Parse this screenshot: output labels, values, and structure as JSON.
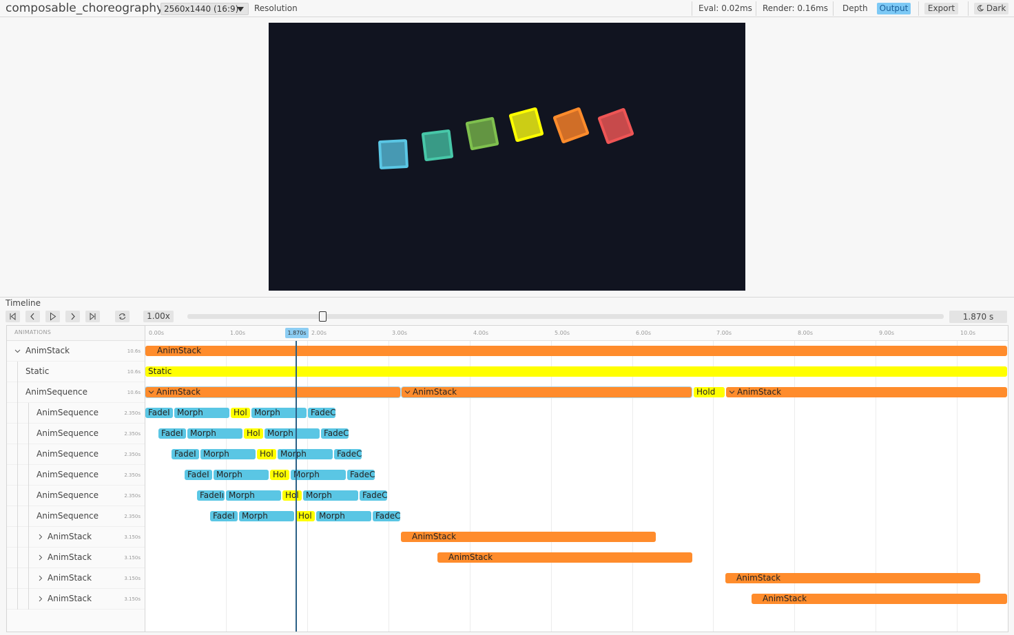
{
  "topbar": {
    "title": "composable_choreography",
    "resolution_value": "2560x1440 (16:9)",
    "resolution_label": "Resolution",
    "eval": "Eval: 0.02ms",
    "render": "Render: 0.16ms",
    "depth": "Depth",
    "output": "Output",
    "export": "Export",
    "dark": "Dark"
  },
  "viewport": {
    "background": "#111420",
    "squares": [
      {
        "color": "#5ac6e4"
      },
      {
        "color": "#47c7a8"
      },
      {
        "color": "#7fc04e"
      },
      {
        "color": "#ffff00"
      },
      {
        "color": "#ff8c2c"
      },
      {
        "color": "#ee5555"
      }
    ]
  },
  "timeline": {
    "title": "Timeline",
    "speed": "1.00x",
    "time": "1.870 s",
    "scrub_fraction": 0.177,
    "header_label": "ANIMATIONS",
    "ticks": [
      "0.00s",
      "1.00s",
      "1.870s",
      "2.00s",
      "3.00s",
      "4.00s",
      "5.00s",
      "6.00s",
      "7.00s",
      "8.00s",
      "9.00s",
      "10.0s"
    ],
    "current_time_label": "1.870s",
    "rows": [
      {
        "name": "AnimStack",
        "duration": "10.6s"
      },
      {
        "name": "Static",
        "duration": "10.6s"
      },
      {
        "name": "AnimSequence",
        "duration": "10.6s"
      },
      {
        "name": "AnimSequence",
        "duration": "2.350s"
      },
      {
        "name": "AnimSequence",
        "duration": "2.350s"
      },
      {
        "name": "AnimSequence",
        "duration": "2.350s"
      },
      {
        "name": "AnimSequence",
        "duration": "2.350s"
      },
      {
        "name": "AnimSequence",
        "duration": "2.350s"
      },
      {
        "name": "AnimSequence",
        "duration": "2.350s"
      },
      {
        "name": "AnimStack",
        "duration": "3.150s"
      },
      {
        "name": "AnimStack",
        "duration": "3.150s"
      },
      {
        "name": "AnimStack",
        "duration": "3.150s"
      },
      {
        "name": "AnimStack",
        "duration": "3.150s"
      }
    ],
    "bar_labels": {
      "animstack": "AnimStack",
      "static": "Static",
      "hold": "Hold",
      "fade_in": "FadeI",
      "fade_in_long": "FadeIı",
      "morph": "Morph",
      "hold_short": "Hol",
      "fade_out": "FadeC"
    }
  }
}
